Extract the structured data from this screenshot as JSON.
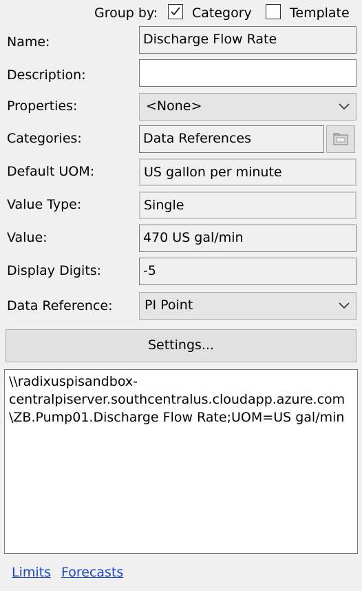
{
  "group_by": {
    "label": "Group by:",
    "category": {
      "label": "Category",
      "checked": true
    },
    "template": {
      "label": "Template",
      "checked": false
    }
  },
  "fields": {
    "name": {
      "label": "Name:",
      "value": "Discharge Flow Rate"
    },
    "description": {
      "label": "Description:",
      "value": ""
    },
    "properties": {
      "label": "Properties:",
      "value": "<None>"
    },
    "categories": {
      "label": "Categories:",
      "value": "Data References"
    },
    "default_uom": {
      "label": "Default UOM:",
      "value": "US gallon per minute"
    },
    "value_type": {
      "label": "Value Type:",
      "value": "Single"
    },
    "value": {
      "label": "Value:",
      "value": "470 US gal/min"
    },
    "display_digits": {
      "label": "Display Digits:",
      "value": "-5"
    },
    "data_reference": {
      "label": "Data Reference:",
      "value": "PI Point"
    }
  },
  "settings_button": {
    "label": "Settings..."
  },
  "config_string": {
    "line1": "\\\\radixuspisandbox-",
    "line2": "centralpiserver.southcentralus.cloudapp.azure.com",
    "line3": "\\ZB.Pump01.Discharge Flow Rate;UOM=US gal/min"
  },
  "links": {
    "limits": "Limits",
    "forecasts": "Forecasts"
  },
  "icons": {
    "checkbox_check": "check-mark-icon",
    "dropdown": "chevron-down-icon",
    "browse": "folder-browse-icon"
  },
  "colors": {
    "background": "#f0f0f0",
    "link": "#1a47c8",
    "field_border": "#7a7a7a"
  }
}
